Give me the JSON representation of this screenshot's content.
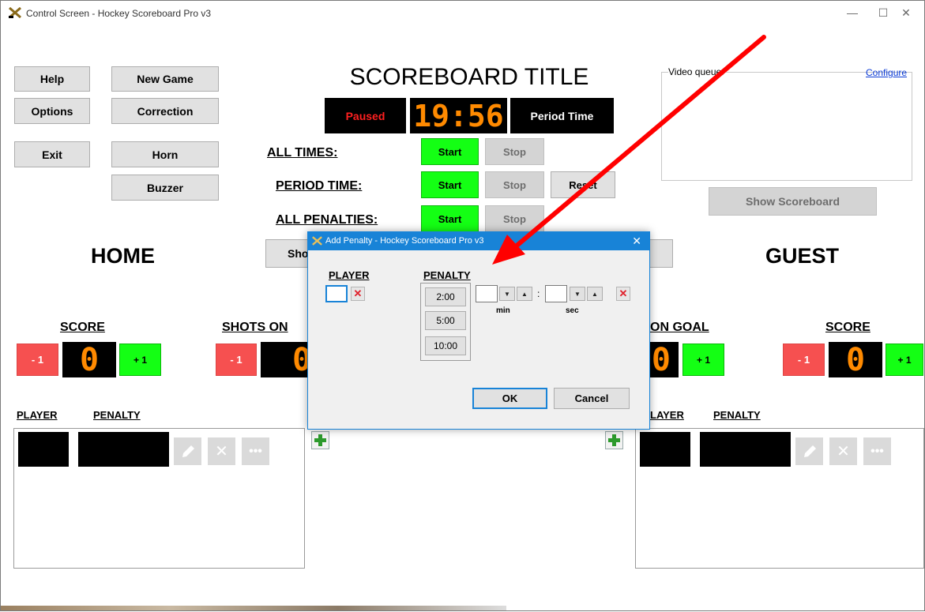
{
  "window": {
    "title": "Control Screen - Hockey Scoreboard Pro v3",
    "minimize": "—",
    "maximize": "☐",
    "close": "✕"
  },
  "left_buttons": {
    "help": "Help",
    "new_game": "New Game",
    "options": "Options",
    "correction": "Correction",
    "exit": "Exit",
    "horn": "Horn",
    "buzzer": "Buzzer"
  },
  "scoreboard": {
    "title": "SCOREBOARD TITLE",
    "status": "Paused",
    "clock": "19:56",
    "time_mode": "Period Time"
  },
  "timers": {
    "all_times": {
      "label": "ALL TIMES:",
      "start": "Start",
      "stop": "Stop"
    },
    "period_time": {
      "label": "PERIOD TIME:",
      "start": "Start",
      "stop": "Stop",
      "reset": "Reset"
    },
    "all_penalties": {
      "label": "ALL PENALTIES:",
      "start": "Start",
      "stop": "Stop"
    }
  },
  "video": {
    "label": "Video queue:",
    "configure": "Configure",
    "show_scoreboard": "Show Scoreboard"
  },
  "home": {
    "name": "HOME",
    "score_label": "SCORE",
    "shots_label": "SHOTS ON",
    "minus": "- 1",
    "plus": "+ 1",
    "score": "0",
    "shots": "0",
    "show_partial": "Sho"
  },
  "guest": {
    "name": "GUEST",
    "score_label": "SCORE",
    "shots_label": "ON GOAL",
    "minus": "- 1",
    "plus": "+ 1",
    "score": "0",
    "shots": "0"
  },
  "penalty_list": {
    "player_header": "PLAYER",
    "penalty_header": "PENALTY",
    "guest_player_header": "LAYER"
  },
  "dialog": {
    "title": "Add Penalty - Hockey Scoreboard Pro v3",
    "close": "✕",
    "player_label": "PLAYER",
    "penalty_label": "PENALTY",
    "presets": [
      "2:00",
      "5:00",
      "10:00"
    ],
    "min_label": "min",
    "sec_label": "sec",
    "separator": ":",
    "ok": "OK",
    "cancel": "Cancel"
  },
  "colors": {
    "green": "#14ff14",
    "red": "#f65050",
    "digit": "#ff8a00",
    "accent": "#1883d7",
    "arrow": "#ff0000"
  }
}
